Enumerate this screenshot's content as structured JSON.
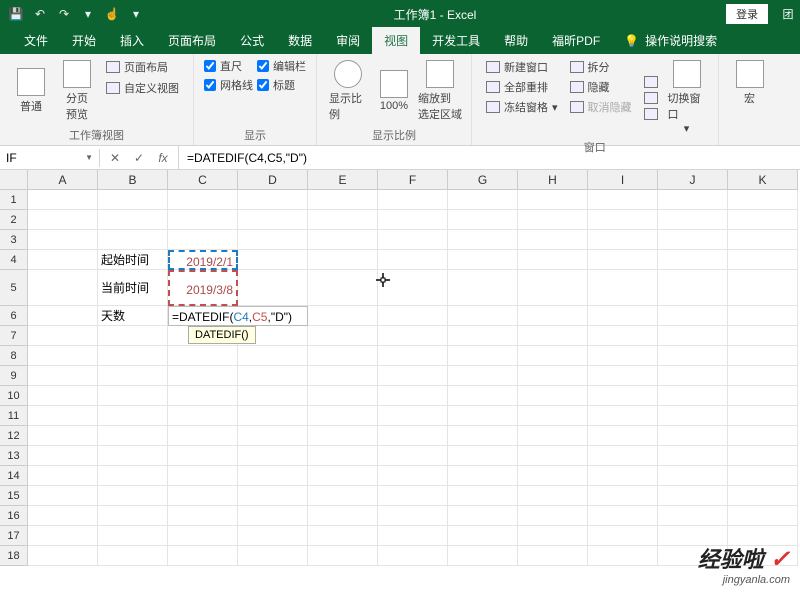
{
  "titlebar": {
    "title": "工作簿1 - Excel",
    "login": "登录",
    "team_icon": "团"
  },
  "tabs": {
    "file": "文件",
    "home": "开始",
    "insert": "插入",
    "layout": "页面布局",
    "formulas": "公式",
    "data": "数据",
    "review": "审阅",
    "view": "视图",
    "dev": "开发工具",
    "help": "帮助",
    "foxit": "福昕PDF",
    "tellme": "操作说明搜索"
  },
  "ribbon": {
    "group1": {
      "normal": "普通",
      "preview": "分页\n预览",
      "page_layout": "页面布局",
      "custom_view": "自定义视图",
      "label": "工作簿视图"
    },
    "group2": {
      "ruler": "直尺",
      "gridlines": "网格线",
      "formula_bar": "编辑栏",
      "headings": "标题",
      "label": "显示"
    },
    "group3": {
      "zoom": "显示比例",
      "hundred": "100%",
      "zoom_sel": "缩放到\n选定区域",
      "label": "显示比例"
    },
    "group4": {
      "new_win": "新建窗口",
      "arrange": "全部重排",
      "freeze": "冻结窗格",
      "split": "拆分",
      "hide": "隐藏",
      "unhide": "取消隐藏",
      "switch": "切换窗口",
      "label": "窗口"
    },
    "group5": {
      "macros": "宏"
    }
  },
  "formula_bar": {
    "name_box": "IF",
    "fx": "fx",
    "formula": "=DATEDIF(C4,C5,\"D\")"
  },
  "grid": {
    "cols": [
      "A",
      "B",
      "C",
      "D",
      "E",
      "F",
      "G",
      "H",
      "I",
      "J",
      "K"
    ],
    "rows": [
      "1",
      "2",
      "3",
      "4",
      "5",
      "6",
      "7",
      "8",
      "9",
      "10",
      "11",
      "12",
      "13",
      "14",
      "15",
      "16",
      "17",
      "18"
    ],
    "b4": "起始时间",
    "b5": "当前时间",
    "b6": "天数",
    "c4": "2019/2/1",
    "c5": "2019/3/8",
    "c6_prefix": "=DATEDIF(",
    "c6_c4": "C4",
    "c6_comma1": ",",
    "c6_c5": "C5",
    "c6_suffix": ",\"D\")",
    "tooltip": "DATEDIF()"
  },
  "watermark": {
    "main": "经验啦",
    "sub": "jingyanla.com"
  }
}
